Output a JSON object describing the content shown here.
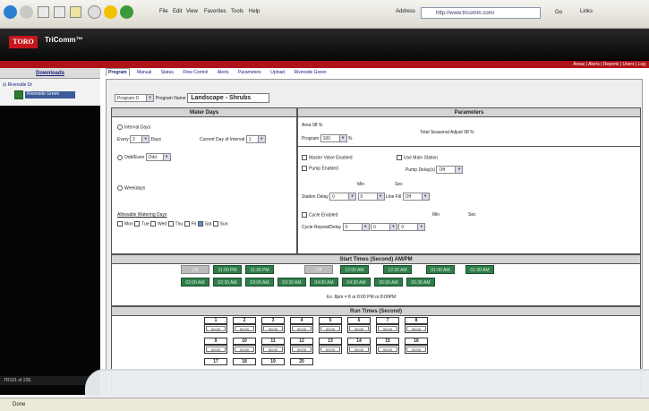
{
  "browser": {
    "menu": [
      "File",
      "Edit",
      "View",
      "Favorites",
      "Tools",
      "Help"
    ],
    "address_label": "Address",
    "address": "http://www.tricomm.com/",
    "go_label": "Go",
    "links_label": "Links"
  },
  "app": {
    "brand": "TORO",
    "product": "TriComm™",
    "toplinks": "Areas | Alerts | Reports | Users | Log"
  },
  "sidebar": {
    "header": "Downloads",
    "root": "Riverside Dr",
    "node": "Riverside Green",
    "footer": "TR101 of 236"
  },
  "tabs": [
    "Program",
    "Manual",
    "Status",
    "Flow Control",
    "Alerts",
    "Parameters",
    "Upload",
    "Riverside Green"
  ],
  "program": {
    "select_value": "Program D",
    "name_label": "Program Name",
    "name_value": "Landscape - Shrubs"
  },
  "water_days": {
    "title": "Water Days",
    "interval_label": "Interval Days",
    "every_label": "Every",
    "every_value": "2",
    "days_label": "Days",
    "current_day_label": "Current Day of Interval",
    "current_day_value": "1",
    "odd_even_label": "Odd/Even",
    "odd_even_value": "Odd",
    "weekdays_label": "Weekdays",
    "allowable_label": "Allowable Watering Days",
    "days": [
      "Mon",
      "Tue",
      "Wed",
      "Thu",
      "Fri",
      "Sat",
      "Sun"
    ],
    "days_checked": [
      false,
      false,
      false,
      false,
      false,
      true,
      false
    ]
  },
  "parameters": {
    "title": "Parameters",
    "area_label": "Area",
    "area_value": "98",
    "area_unit": "%",
    "program_label": "Program",
    "program_value": "100",
    "program_unit": "%",
    "total_label": "Total Seasonal Adjust",
    "total_value": "98 %",
    "master_valve_label": "Master Valve Enabled",
    "use_main_label": "Use Main Station",
    "pump_label": "Pump Enabled",
    "pump_delay_label": "Pump Delay(s)",
    "pump_delay_value": "Off",
    "min_label": "Min",
    "sec_label": "Sec",
    "station_delay_label": "Station Delay",
    "station_min": "0",
    "station_sec": "0",
    "line_fill_label": "Line Fill",
    "line_fill_value": "Off",
    "cycle_label": "Cycle Enabled",
    "cycle_repeat_label": "Cycle Repeat/Delay",
    "cycle_repeat_value": "0",
    "cycle_min": "0",
    "cycle_sec": "0"
  },
  "start_times": {
    "title": "Start Times (Second) AM/PM",
    "row1": [
      "Off",
      "11:00 PM",
      "11:30 PM",
      "Off",
      "12:00 AM",
      "12:30 AM",
      "01:00 AM",
      "01:30 AM"
    ],
    "row2": [
      "02:00 AM",
      "02:30 AM",
      "03:00 AM",
      "03:30 AM",
      "04:00 AM",
      "04:30 AM",
      "05:00 AM",
      "05:30 AM"
    ],
    "note": "Ex. 8pm = 8 or 8:00 PM or 8:00PM"
  },
  "run_times": {
    "title": "Run Times (Second)",
    "stations_row1": [
      "1",
      "2",
      "3",
      "4",
      "5",
      "6",
      "7",
      "8"
    ],
    "stations_row2": [
      "9",
      "10",
      "11",
      "12",
      "13",
      "14",
      "15",
      "16"
    ],
    "values_row1": [
      "00:00",
      "00:00",
      "00:00",
      "00:00",
      "00:00",
      "00:00",
      "00:00",
      "00:00"
    ],
    "values_row2": [
      "00:00",
      "00:00",
      "00:00",
      "00:00",
      "00:00",
      "00:00",
      "00:00",
      "00:00"
    ],
    "stations_row3": [
      "17",
      "18",
      "19",
      "20"
    ]
  },
  "status": {
    "text": "Done"
  },
  "colors": {
    "brand_red": "#b0121a",
    "start_green": "#2e7d4a",
    "link_blue": "#1a237e"
  }
}
